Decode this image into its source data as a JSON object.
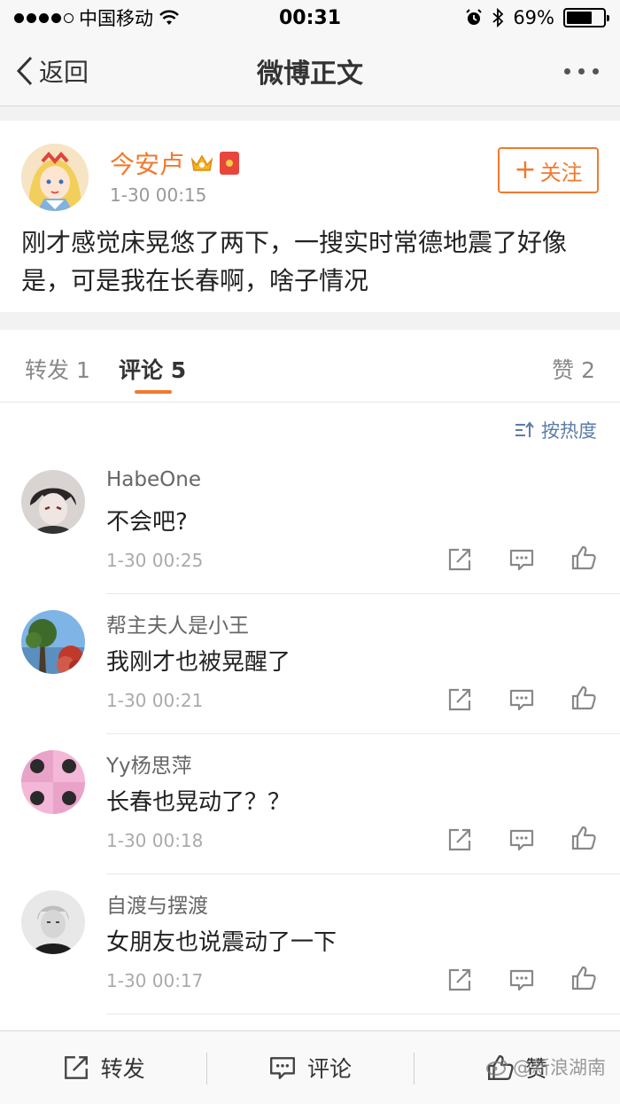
{
  "status_bar": {
    "carrier": "中国移动",
    "time": "00:31",
    "battery": "69%",
    "battery_level": 0.69
  },
  "nav": {
    "back_label": "返回",
    "title": "微博正文"
  },
  "post": {
    "author": "今安卢",
    "time": "1-30 00:15",
    "follow_label": "关注",
    "text": "刚才感觉床晃悠了两下，一搜实时常德地震了好像是，可是我在长春啊，啥子情况"
  },
  "tabs": {
    "repost": "转发 1",
    "comment": "评论 5",
    "like": "赞 2"
  },
  "sort": {
    "label": "按热度"
  },
  "comments": [
    {
      "name": "HabeOne",
      "text": "不会吧?",
      "time": "1-30 00:25"
    },
    {
      "name": "帮主夫人是小王",
      "text": "我刚才也被晃醒了",
      "time": "1-30 00:21"
    },
    {
      "name": "Yy杨思萍",
      "text": "长春也晃动了？？",
      "time": "1-30 00:18"
    },
    {
      "name": "自渡与摆渡",
      "text": "女朋友也说震动了一下",
      "time": "1-30 00:17"
    }
  ],
  "bottom_bar": {
    "repost": "转发",
    "comment": "评论",
    "like": "赞"
  },
  "watermark": "@新浪湖南",
  "colors": {
    "accent": "#f0792f",
    "link": "#5b7ca8"
  }
}
